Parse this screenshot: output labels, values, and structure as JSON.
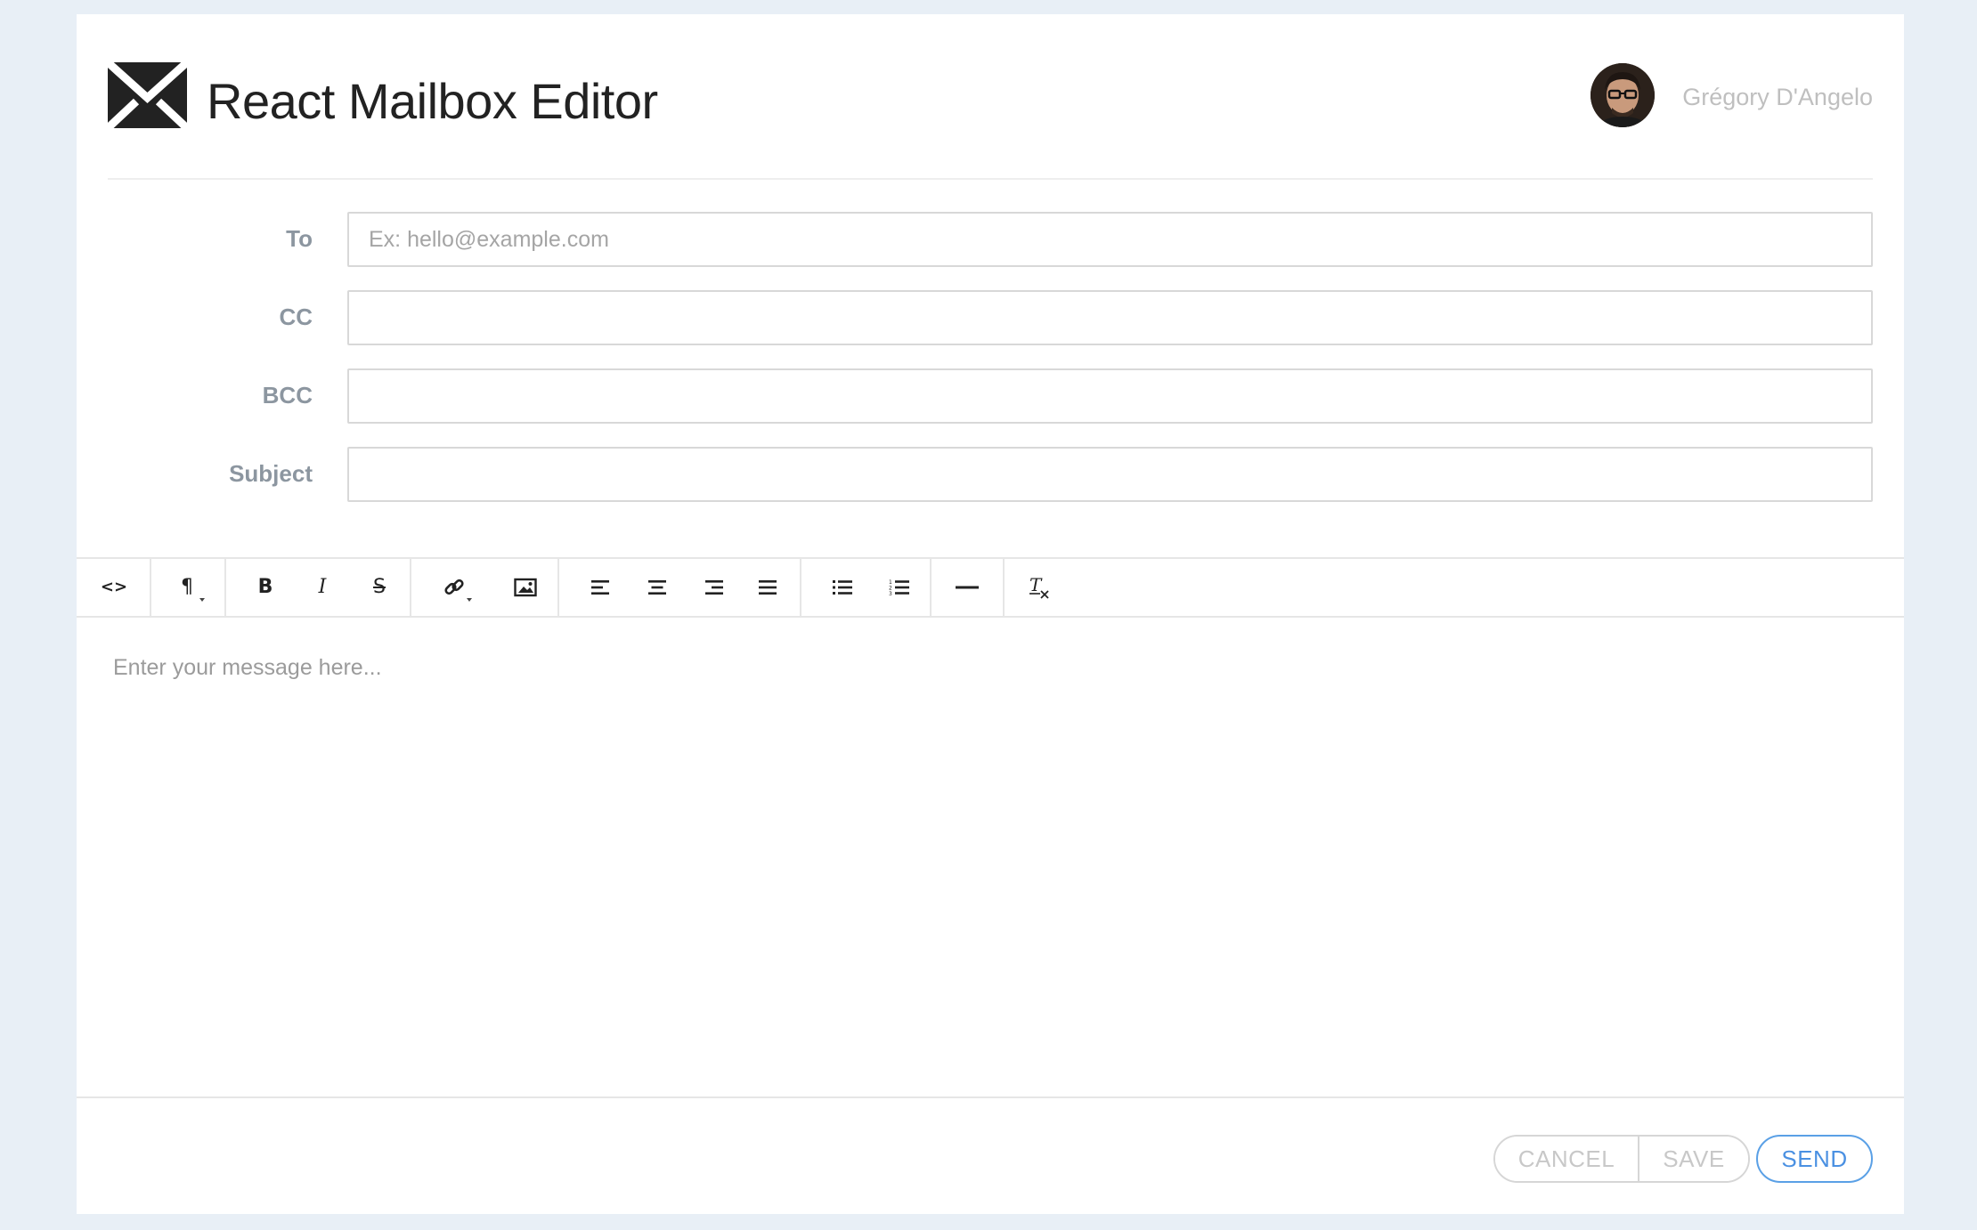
{
  "app": {
    "title": "React Mailbox Editor",
    "logo_icon": "envelope-icon"
  },
  "user": {
    "name": "Grégory D'Angelo",
    "avatar_icon": "user-avatar"
  },
  "form": {
    "to": {
      "label": "To",
      "placeholder": "Ex: hello@example.com",
      "value": ""
    },
    "cc": {
      "label": "CC",
      "placeholder": "",
      "value": ""
    },
    "bcc": {
      "label": "BCC",
      "placeholder": "",
      "value": ""
    },
    "subject": {
      "label": "Subject",
      "placeholder": "",
      "value": ""
    }
  },
  "toolbar": {
    "source": {
      "icon": "code-view-icon",
      "text": "<>"
    },
    "paragraph": {
      "icon": "paragraph-icon",
      "text": "¶"
    },
    "bold": {
      "icon": "bold-icon",
      "text": "B"
    },
    "italic": {
      "icon": "italic-icon",
      "text": "I"
    },
    "strike": {
      "icon": "strikethrough-icon",
      "text": "S"
    },
    "link": {
      "icon": "link-icon"
    },
    "image": {
      "icon": "image-icon"
    },
    "align_left": {
      "icon": "align-left-icon"
    },
    "align_center": {
      "icon": "align-center-icon"
    },
    "align_right": {
      "icon": "align-right-icon"
    },
    "align_justify": {
      "icon": "align-justify-icon"
    },
    "bullet_list": {
      "icon": "bullet-list-icon"
    },
    "numbered_list": {
      "icon": "numbered-list-icon"
    },
    "horizontal_rule": {
      "icon": "horizontal-rule-icon"
    },
    "clear_format": {
      "icon": "clear-format-icon"
    }
  },
  "editor": {
    "placeholder": "Enter your message here..."
  },
  "actions": {
    "cancel": "CANCEL",
    "save": "SAVE",
    "send": "SEND"
  },
  "colors": {
    "background": "#e8eff6",
    "card": "#ffffff",
    "title": "#222222",
    "label": "#8c96a0",
    "send_accent": "#4a90e2",
    "muted_button": "#c8c8c8"
  }
}
